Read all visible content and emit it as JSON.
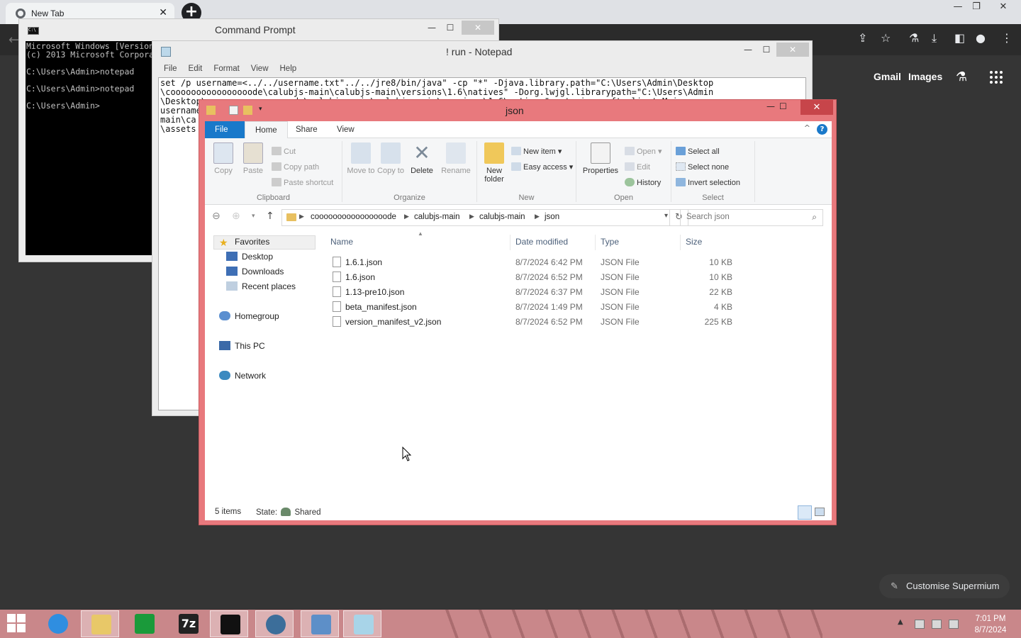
{
  "browser": {
    "tab_title": "New Tab",
    "close_symbol": "✕",
    "new_tab_symbol": "+",
    "links": {
      "gmail": "Gmail",
      "images": "Images"
    },
    "customise_label": "Customise Supermium"
  },
  "cmd": {
    "title": "Command Prompt",
    "lines": "Microsoft Windows [Version\n(c) 2013 Microsoft Corporation\n\nC:\\Users\\Admin>notepad\n\nC:\\Users\\Admin>notepad\n\nC:\\Users\\Admin>"
  },
  "notepad": {
    "title": "! run - Notepad",
    "menu": [
      "File",
      "Edit",
      "Format",
      "View",
      "Help"
    ],
    "text": "set /p username=<../../username.txt\"../../jre8/bin/java\" -cp \"*\" -Djava.library.path=\"C:\\Users\\Admin\\Desktop\n\\coooooooooooooooode\\calubjs-main\\calubjs-main\\versions\\1.6\\natives\" -Dorg.lwjgl.librarypath=\"C:\\Users\\Admin\n\\Desktop\\coooooooooooooooode\\calubjs-main\\calubjs-main\\versions\\1.6\\natives\" net.minecraft.client.Main\nusername\nmain\\ca\n\\assets"
  },
  "explorer": {
    "title": "json",
    "ribbon_tabs": {
      "file": "File",
      "home": "Home",
      "share": "Share",
      "view": "View"
    },
    "help_symbol": "?",
    "clipboard": {
      "label": "Clipboard",
      "copy": "Copy",
      "paste": "Paste",
      "cut": "Cut",
      "copy_path": "Copy path",
      "paste_shortcut": "Paste shortcut"
    },
    "organize": {
      "label": "Organize",
      "move_to": "Move to",
      "copy_to": "Copy to",
      "delete": "Delete",
      "rename": "Rename"
    },
    "new_group": {
      "label": "New",
      "new_folder": "New folder",
      "new_item": "New item",
      "easy_access": "Easy access"
    },
    "open_group": {
      "label": "Open",
      "properties": "Properties",
      "open": "Open",
      "edit": "Edit",
      "history": "History"
    },
    "select_group": {
      "label": "Select",
      "select_all": "Select all",
      "select_none": "Select none",
      "invert_selection": "Invert selection"
    },
    "breadcrumb": [
      "coooooooooooooooode",
      "calubjs-main",
      "calubjs-main",
      "json"
    ],
    "search_placeholder": "Search json",
    "nav": {
      "favorites": "Favorites",
      "desktop": "Desktop",
      "downloads": "Downloads",
      "recent_places": "Recent places",
      "homegroup": "Homegroup",
      "this_pc": "This PC",
      "network": "Network"
    },
    "columns": {
      "name": "Name",
      "date": "Date modified",
      "type": "Type",
      "size": "Size"
    },
    "files": [
      {
        "name": "1.6.1.json",
        "date": "8/7/2024 6:42 PM",
        "type": "JSON File",
        "size": "10 KB"
      },
      {
        "name": "1.6.json",
        "date": "8/7/2024 6:52 PM",
        "type": "JSON File",
        "size": "10 KB"
      },
      {
        "name": "1.13-pre10.json",
        "date": "8/7/2024 6:37 PM",
        "type": "JSON File",
        "size": "22 KB"
      },
      {
        "name": "beta_manifest.json",
        "date": "8/7/2024 1:49 PM",
        "type": "JSON File",
        "size": "4 KB"
      },
      {
        "name": "version_manifest_v2.json",
        "date": "8/7/2024 6:52 PM",
        "type": "JSON File",
        "size": "225 KB"
      }
    ],
    "status": {
      "count": "5 items",
      "state_label": "State:",
      "state_value": "Shared"
    }
  },
  "taskbar": {
    "clock_time": "7:01 PM",
    "clock_date": "8/7/2024",
    "sevenzip_label": "7z"
  },
  "colors": {
    "explorer_frame": "#e8797d",
    "file_tab": "#1979ca",
    "taskbar": "#c9878a"
  }
}
